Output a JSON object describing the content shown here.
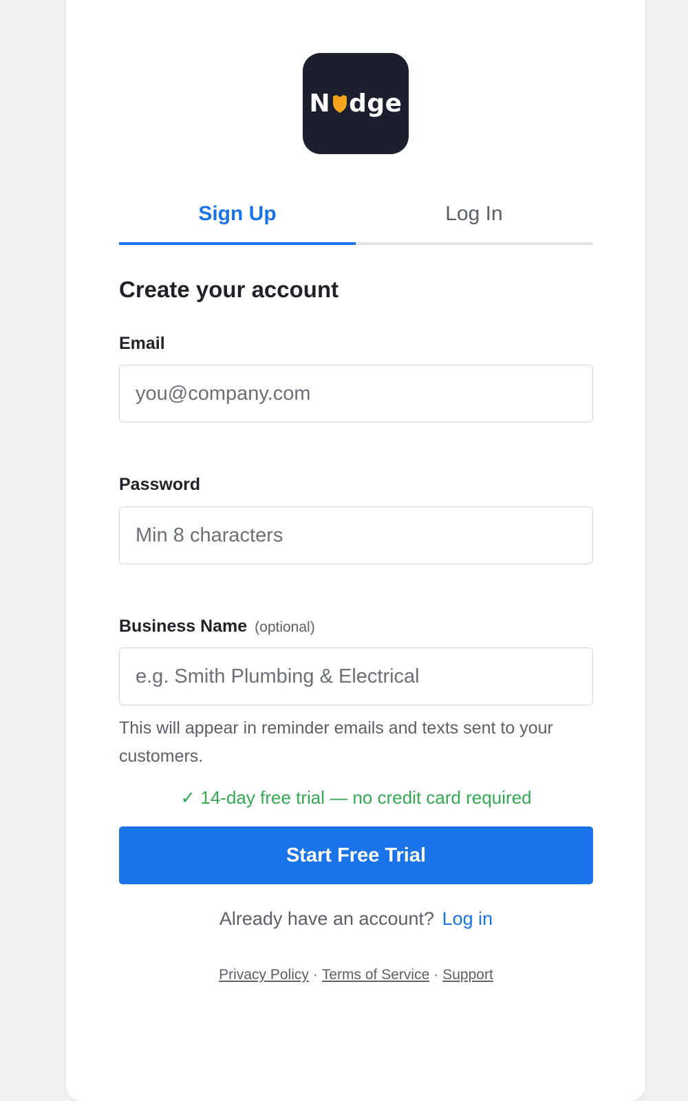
{
  "brand": {
    "logo_text_left": "N",
    "logo_text_right": "dge",
    "logo_bg": "#1c1f2d",
    "logo_accent": "#f4a51c",
    "logo_icon": "shield-icon"
  },
  "tabs": [
    {
      "label": "Sign Up",
      "active": true
    },
    {
      "label": "Log In",
      "active": false
    }
  ],
  "form": {
    "title": "Create your account",
    "email": {
      "label": "Email",
      "placeholder": "you@company.com",
      "value": ""
    },
    "password": {
      "label": "Password",
      "placeholder": "Min 8 characters",
      "value": ""
    },
    "business": {
      "label": "Business Name",
      "optional": "(optional)",
      "placeholder": "e.g. Smith Plumbing & Electrical",
      "value": "",
      "hint": "This will appear in reminder emails and texts sent to your customers."
    },
    "trial_note": "✓ 14-day free trial — no credit card required",
    "submit_label": "Start Free Trial"
  },
  "switch_prompt": {
    "text": "Already have an account?",
    "link": "Log in"
  },
  "footer": {
    "links": [
      "Privacy Policy",
      "Terms of Service",
      "Support"
    ],
    "separator": "·"
  },
  "colors": {
    "accent": "#1a73e8",
    "success": "#34a853",
    "page_bg": "#f1f1f2"
  }
}
